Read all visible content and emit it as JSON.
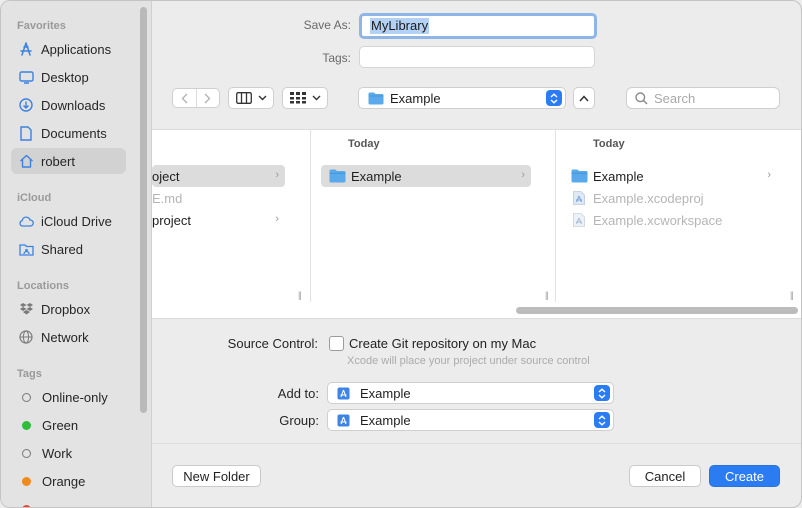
{
  "sidebar": {
    "favorites_header": "Favorites",
    "favorites": [
      {
        "label": "Applications",
        "icon": "applications-icon"
      },
      {
        "label": "Desktop",
        "icon": "desktop-icon"
      },
      {
        "label": "Downloads",
        "icon": "downloads-icon"
      },
      {
        "label": "Documents",
        "icon": "documents-icon"
      },
      {
        "label": "robert",
        "icon": "home-icon"
      }
    ],
    "icloud_header": "iCloud",
    "icloud": [
      {
        "label": "iCloud Drive",
        "icon": "cloud-icon"
      },
      {
        "label": "Shared",
        "icon": "shared-folder-icon"
      }
    ],
    "locations_header": "Locations",
    "locations": [
      {
        "label": "Dropbox",
        "icon": "dropbox-icon"
      },
      {
        "label": "Network",
        "icon": "network-icon"
      }
    ],
    "tags_header": "Tags",
    "tags": [
      {
        "label": "Online-only",
        "color": ""
      },
      {
        "label": "Green",
        "color": "#2fbd3a"
      },
      {
        "label": "Work",
        "color": ""
      },
      {
        "label": "Orange",
        "color": "#f08a1c"
      }
    ]
  },
  "form": {
    "save_as_label": "Save As:",
    "save_as_value": "MyLibrary",
    "tags_label": "Tags:",
    "tags_value": ""
  },
  "toolbar": {
    "location": "Example",
    "search_placeholder": "Search"
  },
  "browser": {
    "col1": {
      "rows": [
        {
          "label": "oject",
          "selected": true,
          "chevron": true,
          "dim": false
        },
        {
          "label": "E.md",
          "selected": false,
          "chevron": false,
          "dim": true
        },
        {
          "label": "project",
          "selected": false,
          "chevron": true,
          "dim": false
        }
      ]
    },
    "col2": {
      "header": "Today",
      "rows": [
        {
          "label": "Example",
          "selected": true,
          "chevron": true
        }
      ]
    },
    "col3": {
      "header": "Today",
      "rows": [
        {
          "label": "Example",
          "chevron": true,
          "dim": false
        },
        {
          "label": "Example.xcodeproj",
          "chevron": false,
          "dim": true
        },
        {
          "label": "Example.xcworkspace",
          "chevron": false,
          "dim": true
        }
      ]
    }
  },
  "options": {
    "source_control_label": "Source Control:",
    "git_checkbox_label": "Create Git repository on my Mac",
    "git_hint": "Xcode will place your project under source control",
    "add_to_label": "Add to:",
    "add_to_value": "Example",
    "group_label": "Group:",
    "group_value": "Example"
  },
  "buttons": {
    "new_folder": "New Folder",
    "cancel": "Cancel",
    "create": "Create"
  },
  "colors": {
    "accent": "#2b7cf3",
    "folder": "#5aa9ea"
  }
}
